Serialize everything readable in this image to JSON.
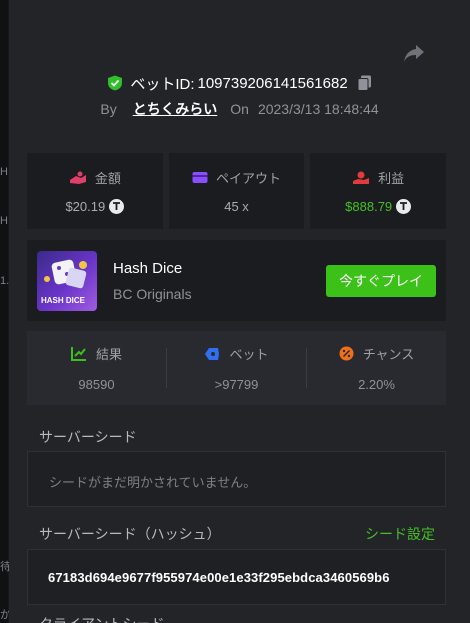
{
  "bet": {
    "label": "ベットID:",
    "id": "109739206141561682",
    "by_label": "By",
    "user": "とちくみらい",
    "on_label": "On",
    "datetime": "2023/3/13 18:48:44"
  },
  "stats": {
    "amount": {
      "label": "金額",
      "value": "$20.19"
    },
    "payout": {
      "label": "ペイアウト",
      "value": "45 x"
    },
    "profit": {
      "label": "利益",
      "value": "$888.79"
    }
  },
  "game": {
    "name": "Hash Dice",
    "provider": "BC Originals",
    "thumb_label": "HASH DICE",
    "play_label": "今すぐプレイ"
  },
  "result": {
    "result": {
      "label": "結果",
      "value": "98590"
    },
    "bet": {
      "label": "ベット",
      "value": ">97799"
    },
    "chance": {
      "label": "チャンス",
      "value": "2.20%"
    }
  },
  "seeds": {
    "server_label": "サーバーシード",
    "server_value": "シードがまだ明かされていません。",
    "hash_label": "サーバーシード（ハッシュ）",
    "settings_label": "シード設定",
    "hash_value": "67183d694e9677f955974e00e1e33f295ebdca3460569b6",
    "client_label": "クライアントシード"
  },
  "background": {
    "glyph_1": "H",
    "glyph_2": "H",
    "glyph_3": "1.",
    "glyph_4": "待",
    "glyph_5": "か"
  },
  "colors": {
    "accent_green": "#3bc117",
    "profit_green": "#45c023",
    "panel": "#232428",
    "card": "#1b1c1f"
  },
  "icons": {
    "share": "share-icon",
    "shield": "shield-check-icon",
    "copy": "copy-icon",
    "amount": "coin-hand-icon",
    "payout": "wallet-icon",
    "profit": "money-bag-icon",
    "tether": "tether-icon",
    "result": "chart-icon",
    "bet": "ticket-icon",
    "chance": "percent-icon"
  }
}
